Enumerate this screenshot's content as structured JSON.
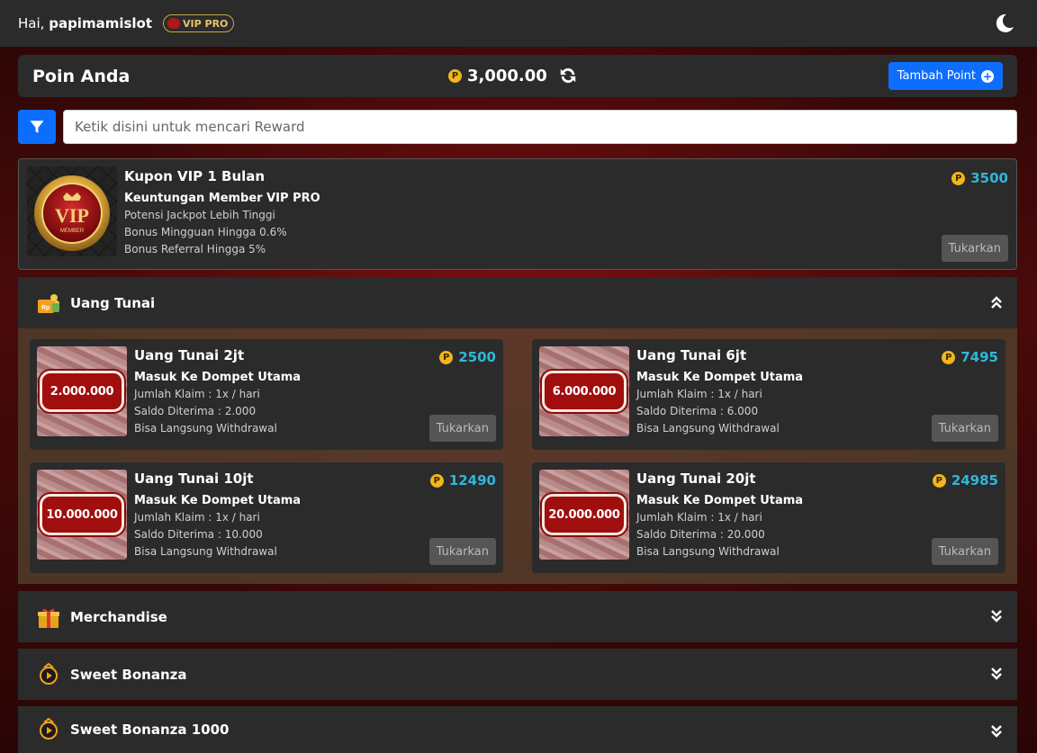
{
  "header": {
    "greeting": "Hai,",
    "username": "papimamislot",
    "vip_badge": "VIP PRO"
  },
  "points": {
    "title": "Poin Anda",
    "coin_symbol": "P",
    "balance": "3,000.00",
    "add_button": "Tambah Point"
  },
  "search": {
    "placeholder": "Ketik disini untuk mencari Reward"
  },
  "featured": {
    "title": "Kupon VIP 1 Bulan",
    "price": "3500",
    "subtitle": "Keuntungan Member VIP PRO",
    "lines": [
      "Potensi Jackpot Lebih Tinggi",
      "Bonus Mingguan Hingga 0.6%",
      "Bonus Referral Hingga 5%"
    ],
    "button": "Tukarkan",
    "badge_text": "VIP",
    "badge_sub": "MEMBER"
  },
  "categories": [
    {
      "label": "Uang Tunai",
      "icon": "cash-bag-icon",
      "expanded": true
    },
    {
      "label": "Merchandise",
      "icon": "gift-icon",
      "expanded": false
    },
    {
      "label": "Sweet Bonanza",
      "icon": "play-logo-icon",
      "expanded": false
    },
    {
      "label": "Sweet Bonanza 1000",
      "icon": "play-logo-icon",
      "expanded": false
    }
  ],
  "cash_items": [
    {
      "title": "Uang Tunai 2jt",
      "price": "2500",
      "plate": "2.000.000",
      "subtitle": "Masuk Ke Dompet Utama",
      "claim": "Jumlah Klaim : 1x / hari",
      "received": "Saldo Diterima : 2.000",
      "note": "Bisa Langsung Withdrawal",
      "button": "Tukarkan"
    },
    {
      "title": "Uang Tunai 6jt",
      "price": "7495",
      "plate": "6.000.000",
      "subtitle": "Masuk Ke Dompet Utama",
      "claim": "Jumlah Klaim : 1x / hari",
      "received": "Saldo Diterima : 6.000",
      "note": "Bisa Langsung Withdrawal",
      "button": "Tukarkan"
    },
    {
      "title": "Uang Tunai 10jt",
      "price": "12490",
      "plate": "10.000.000",
      "subtitle": "Masuk Ke Dompet Utama",
      "claim": "Jumlah Klaim : 1x / hari",
      "received": "Saldo Diterima : 10.000",
      "note": "Bisa Langsung Withdrawal",
      "button": "Tukarkan"
    },
    {
      "title": "Uang Tunai 20jt",
      "price": "24985",
      "plate": "20.000.000",
      "subtitle": "Masuk Ke Dompet Utama",
      "claim": "Jumlah Klaim : 1x / hari",
      "received": "Saldo Diterima : 20.000",
      "note": "Bisa Langsung Withdrawal",
      "button": "Tukarkan"
    }
  ],
  "colors": {
    "accent_blue": "#0d6efd",
    "price_cyan": "#2fb7d9",
    "coin_gold": "#f2b51c"
  }
}
